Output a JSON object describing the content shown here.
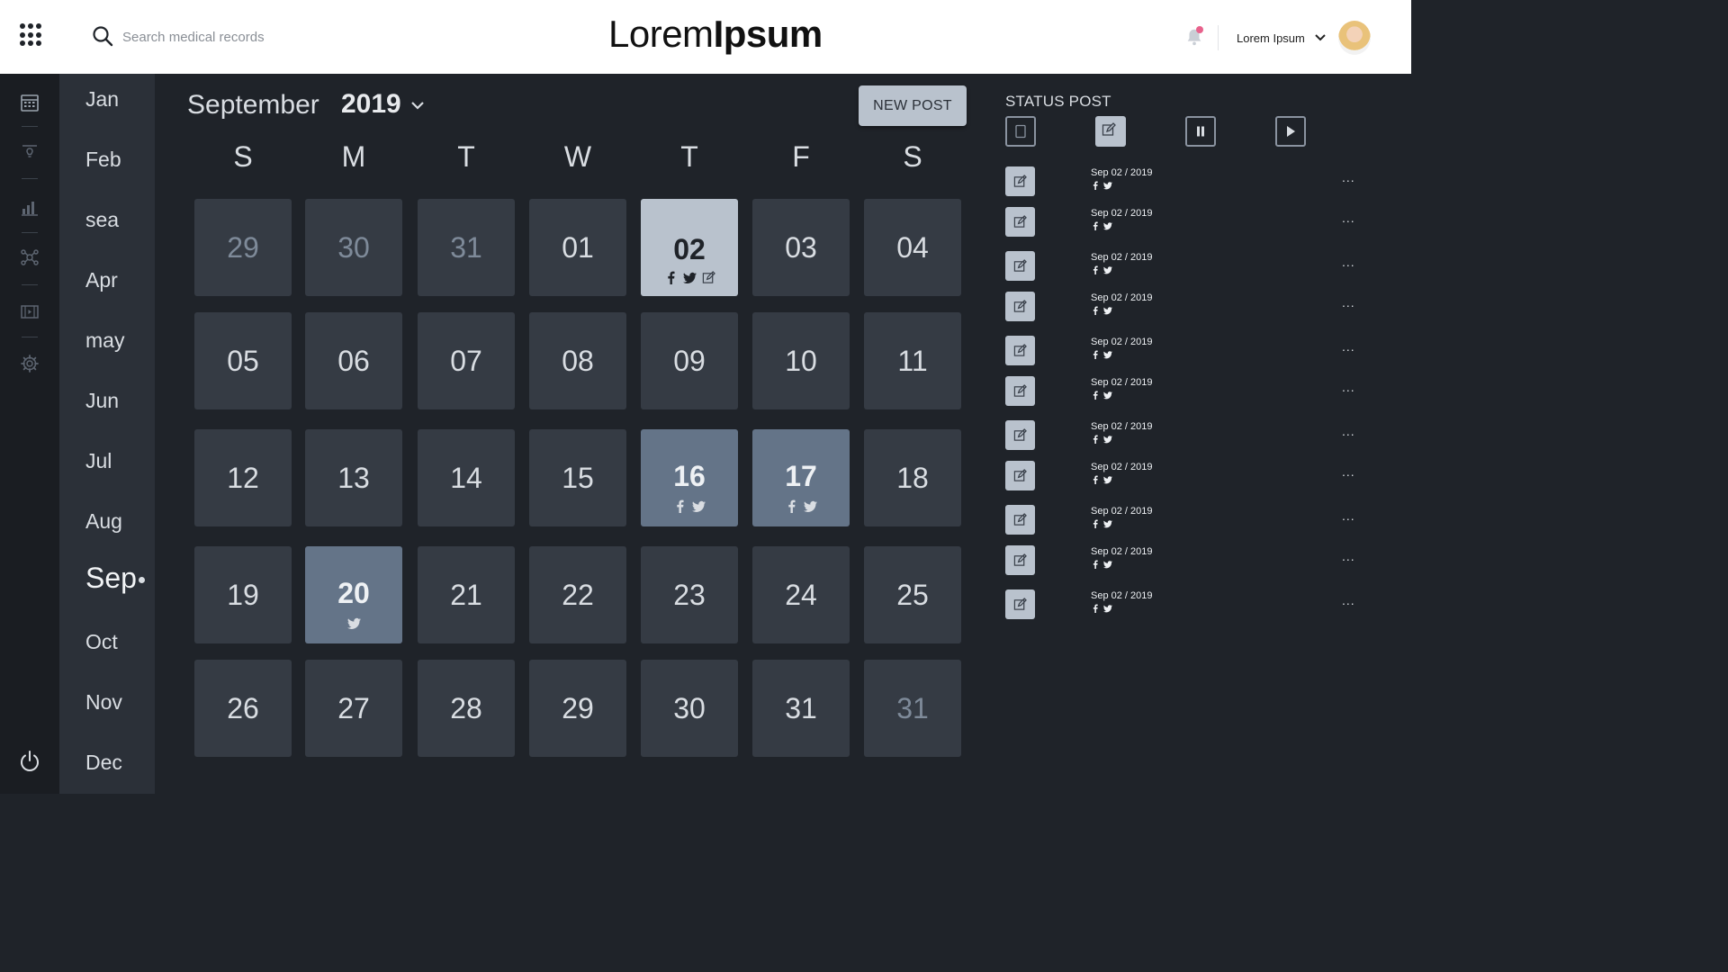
{
  "header": {
    "search_placeholder": "Search medical records",
    "logo_light": "Lorem",
    "logo_bold": "Ipsum",
    "user_name": "Lorem Ipsum",
    "notification_dot_color": "#e8628c"
  },
  "rail": {
    "icons": [
      "calendar-icon",
      "lamp-icon",
      "bar-chart-icon",
      "network-icon",
      "media-icon",
      "gear-icon"
    ],
    "bottom_icon": "power-icon"
  },
  "months": [
    "Jan",
    "Feb",
    "sea",
    "Apr",
    "may",
    "Jun",
    "Jul",
    "Aug",
    "Sep",
    "Oct",
    "Nov",
    "Dec"
  ],
  "active_month_index": 8,
  "calendar": {
    "month": "September",
    "year": "2019",
    "new_post_label": "NEW POST",
    "weekdays": [
      "S",
      "M",
      "T",
      "W",
      "T",
      "F",
      "S"
    ],
    "days": [
      {
        "n": "29",
        "state": "muted"
      },
      {
        "n": "30",
        "state": "muted"
      },
      {
        "n": "31",
        "state": "muted"
      },
      {
        "n": "01"
      },
      {
        "n": "02",
        "state": "light",
        "icons": [
          "facebook",
          "twitter",
          "edit"
        ]
      },
      {
        "n": "03"
      },
      {
        "n": "04"
      },
      {
        "n": "05"
      },
      {
        "n": "06"
      },
      {
        "n": "07"
      },
      {
        "n": "08"
      },
      {
        "n": "09"
      },
      {
        "n": "10"
      },
      {
        "n": "11"
      },
      {
        "n": "12"
      },
      {
        "n": "13"
      },
      {
        "n": "14"
      },
      {
        "n": "15"
      },
      {
        "n": "16",
        "state": "hl",
        "icons": [
          "facebook",
          "twitter"
        ]
      },
      {
        "n": "17",
        "state": "hl",
        "icons": [
          "facebook",
          "twitter"
        ]
      },
      {
        "n": "18"
      },
      {
        "n": "19"
      },
      {
        "n": "20",
        "state": "hl",
        "icons": [
          "twitter"
        ]
      },
      {
        "n": "21"
      },
      {
        "n": "22"
      },
      {
        "n": "23"
      },
      {
        "n": "24"
      },
      {
        "n": "25"
      },
      {
        "n": "26"
      },
      {
        "n": "27"
      },
      {
        "n": "28"
      },
      {
        "n": "29"
      },
      {
        "n": "30"
      },
      {
        "n": "31"
      },
      {
        "n": "31",
        "state": "muted"
      }
    ]
  },
  "status_post": {
    "title": "STATUS POST",
    "filters": [
      "draft-icon",
      "edit-icon",
      "pause-icon",
      "play-icon"
    ],
    "posts": [
      {
        "date": "Sep 02 / 2019",
        "more": "..."
      },
      {
        "date": "Sep 02 / 2019",
        "more": "..."
      },
      {
        "date": "Sep 02 / 2019",
        "more": "..."
      },
      {
        "date": "Sep 02 / 2019",
        "more": "..."
      },
      {
        "date": "Sep 02 / 2019",
        "more": "..."
      },
      {
        "date": "Sep 02 / 2019",
        "more": "..."
      },
      {
        "date": "Sep 02 / 2019",
        "more": "..."
      },
      {
        "date": "Sep 02 / 2019",
        "more": "..."
      },
      {
        "date": "Sep 02 / 2019",
        "more": "..."
      },
      {
        "date": "Sep 02 / 2019",
        "more": "..."
      },
      {
        "date": "Sep 02 / 2019",
        "more": "..."
      }
    ]
  }
}
